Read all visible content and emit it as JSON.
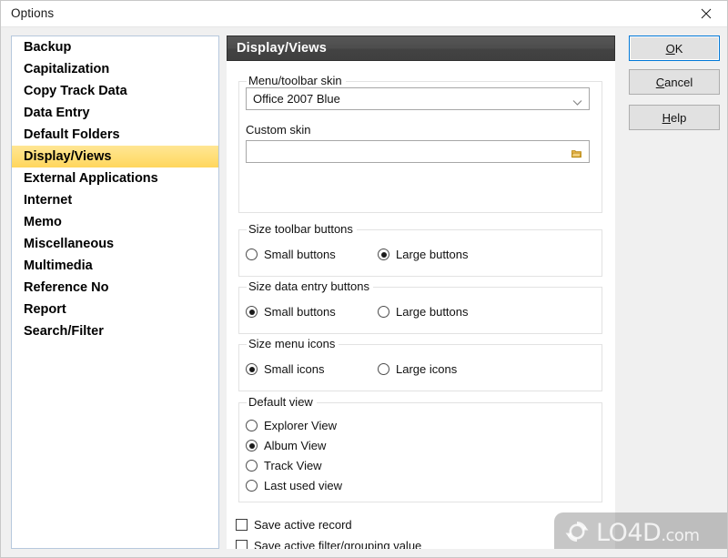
{
  "window": {
    "title": "Options",
    "close_icon": "close-icon"
  },
  "sidebar": {
    "items": [
      {
        "label": "Backup",
        "selected": false
      },
      {
        "label": "Capitalization",
        "selected": false
      },
      {
        "label": "Copy Track Data",
        "selected": false
      },
      {
        "label": "Data Entry",
        "selected": false
      },
      {
        "label": "Default Folders",
        "selected": false
      },
      {
        "label": "Display/Views",
        "selected": true
      },
      {
        "label": "External Applications",
        "selected": false
      },
      {
        "label": "Internet",
        "selected": false
      },
      {
        "label": "Memo",
        "selected": false
      },
      {
        "label": "Miscellaneous",
        "selected": false
      },
      {
        "label": "Multimedia",
        "selected": false
      },
      {
        "label": "Reference No",
        "selected": false
      },
      {
        "label": "Report",
        "selected": false
      },
      {
        "label": "Search/Filter",
        "selected": false
      }
    ],
    "selected_highlight_color": "#ffd65c"
  },
  "buttons": {
    "ok": {
      "label": "OK",
      "accel": "O",
      "focused": true
    },
    "cancel": {
      "label": "Cancel",
      "accel": "C",
      "focused": false
    },
    "help": {
      "label": "Help",
      "accel": "H",
      "focused": false
    },
    "focus_border_color": "#0078d7"
  },
  "main": {
    "header_title": "Display/Views",
    "header_color": "#4a4a4a",
    "skin_group": {
      "legend": "Menu/toolbar skin",
      "combo": {
        "value": "Office 2007 Blue",
        "arrow_icon": "chevron-down-icon"
      },
      "custom_skin_label": "Custom skin",
      "custom_skin_value": "",
      "custom_skin_placeholder": "",
      "browse_icon": "folder-icon",
      "browse_icon_color": "#d9a021"
    },
    "toolbar_buttons_group": {
      "legend": "Size toolbar buttons",
      "options": [
        {
          "label": "Small buttons",
          "checked": false
        },
        {
          "label": "Large buttons",
          "checked": true
        }
      ]
    },
    "data_entry_buttons_group": {
      "legend": "Size data entry buttons",
      "options": [
        {
          "label": "Small buttons",
          "checked": true
        },
        {
          "label": "Large buttons",
          "checked": false
        }
      ]
    },
    "menu_icons_group": {
      "legend": "Size menu icons",
      "options": [
        {
          "label": "Small icons",
          "checked": true
        },
        {
          "label": "Large icons",
          "checked": false
        }
      ]
    },
    "default_view_group": {
      "legend": "Default view",
      "options": [
        {
          "label": "Explorer View",
          "checked": false
        },
        {
          "label": "Album View",
          "checked": true
        },
        {
          "label": "Track View",
          "checked": false
        },
        {
          "label": "Last used view",
          "checked": false
        }
      ]
    },
    "checkboxes": [
      {
        "label": "Save active record",
        "checked": false
      },
      {
        "label": "Save active filter/grouping value",
        "checked": false
      }
    ]
  },
  "watermark": {
    "name": "LO4D",
    "suffix": ".com",
    "logo_icon": "refresh-circle-icon"
  }
}
